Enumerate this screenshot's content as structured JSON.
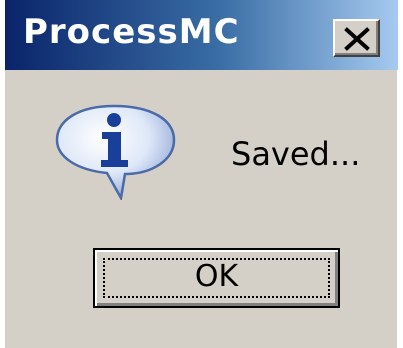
{
  "dialog": {
    "title": "ProcessMC",
    "message": "Saved...",
    "ok_label": "OK",
    "icon": "information-icon"
  }
}
